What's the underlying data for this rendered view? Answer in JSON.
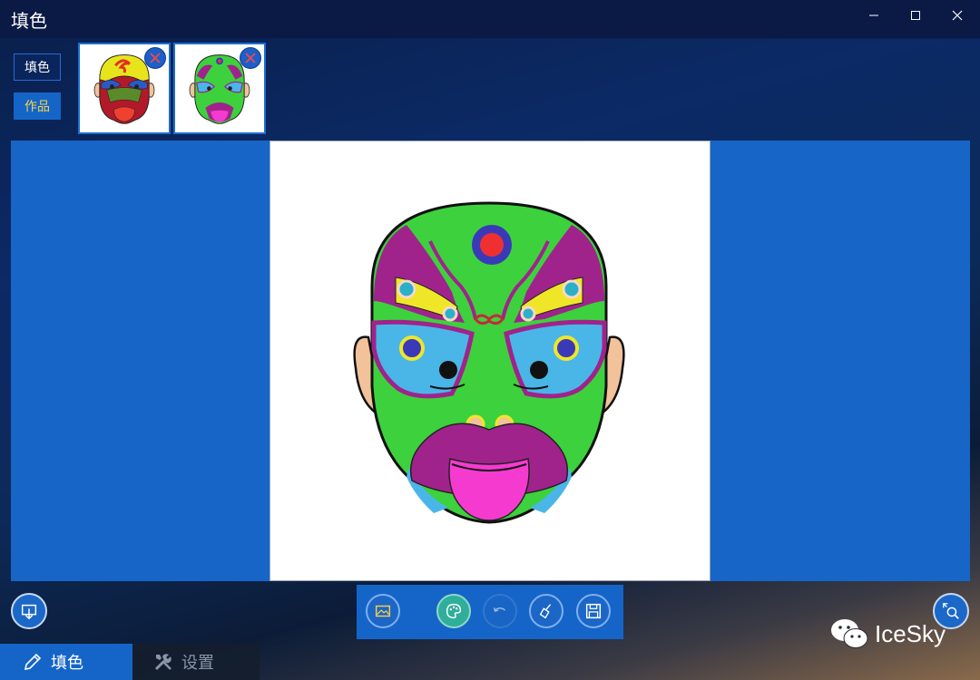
{
  "window": {
    "title": "填色"
  },
  "sidebar": {
    "fill_label": "填色",
    "works_label": "作品"
  },
  "thumbnails": [
    {
      "name": "mask-red-yellow"
    },
    {
      "name": "mask-green-purple"
    }
  ],
  "toolbar": {
    "buttons": [
      "gallery-icon",
      "palette-icon",
      "undo-icon",
      "clear-icon",
      "save-icon"
    ]
  },
  "nav": {
    "fill_label": "填色",
    "settings_label": "设置"
  },
  "watermark": {
    "text": "IceSky"
  },
  "colors": {
    "accent": "#1565c8",
    "mask_green": "#3dd13d",
    "mask_purple": "#a0238c",
    "mask_blue": "#4ab6e8",
    "mask_yellow": "#f0e628",
    "mask_pink": "#f53ad0",
    "mask_red": "#f03030"
  }
}
